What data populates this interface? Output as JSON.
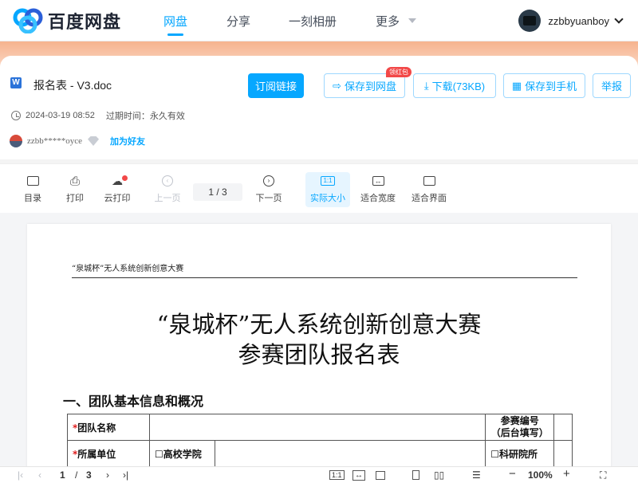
{
  "brand": {
    "name": "百度网盘"
  },
  "nav": {
    "items": [
      "网盘",
      "分享",
      "一刻相册",
      "更多"
    ]
  },
  "user": {
    "name": "zzbbyuanboy"
  },
  "file": {
    "name": "报名表 - V3.doc",
    "date": "2024-03-19 08:52",
    "expiry": "过期时间：永久有效",
    "sharer": "zzbb*****oyce",
    "add_friend": "加为好友"
  },
  "actions": {
    "subscribe": "订阅链接",
    "save": "保存到网盘",
    "save_badge": "领红包",
    "download": "下载(73KB)",
    "save_phone": "保存到手机",
    "report": "举报"
  },
  "toolbar": {
    "catalog": "目录",
    "print": "打印",
    "cloud_print": "云打印",
    "prev": "上一页",
    "page": "1  /  3",
    "next": "下一页",
    "actual_size": "实际大小",
    "fit_width": "适合宽度",
    "fit_page": "适合界面"
  },
  "document": {
    "header": "“泉城杯”无人系统创新创意大赛",
    "title_line1": "“泉城杯”无人系统创新创意大赛",
    "title_line2": "参赛团队报名表",
    "section1": "一、团队基本信息和概况",
    "table": {
      "team_name_label": "团队名称",
      "entry_no_label_1": "参赛编号",
      "entry_no_label_2": "（后台填写）",
      "unit_label": "所属单位",
      "option_university": "☐高校学院",
      "option_research": "☐科研院所",
      "required_mark": "*"
    }
  },
  "bottombar": {
    "current_page": "1",
    "sep": "/",
    "total_pages": "3",
    "zoom": "100%"
  },
  "colors": {
    "accent": "#06a7ff",
    "badge": "#f24848"
  }
}
